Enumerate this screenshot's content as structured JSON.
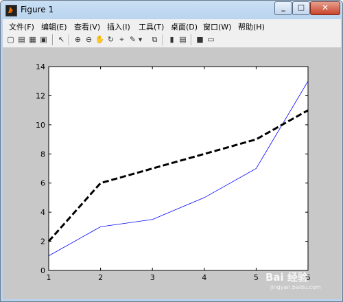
{
  "window": {
    "title": "Figure 1",
    "minimize_glyph": "_",
    "maximize_glyph": "□",
    "close_glyph": "✕"
  },
  "menu": {
    "items": [
      {
        "label": "文件(F)"
      },
      {
        "label": "编辑(E)"
      },
      {
        "label": "查看(V)"
      },
      {
        "label": "插入(I)"
      },
      {
        "label": "工具(T)"
      },
      {
        "label": "桌面(D)"
      },
      {
        "label": "窗口(W)"
      },
      {
        "label": "帮助(H)"
      }
    ]
  },
  "toolbar": {
    "icons": [
      {
        "name": "new-figure-icon",
        "glyph": "▢"
      },
      {
        "name": "open-file-icon",
        "glyph": "▤"
      },
      {
        "name": "save-icon",
        "glyph": "▦"
      },
      {
        "name": "print-icon",
        "glyph": "▣"
      },
      {
        "name": "select-arrow-icon",
        "glyph": "↖"
      },
      {
        "name": "zoom-in-icon",
        "glyph": "⊕"
      },
      {
        "name": "zoom-out-icon",
        "glyph": "⊖"
      },
      {
        "name": "pan-hand-icon",
        "glyph": "✋"
      },
      {
        "name": "rotate-3d-icon",
        "glyph": "↻"
      },
      {
        "name": "data-cursor-icon",
        "glyph": "⌖"
      },
      {
        "name": "brush-icon",
        "glyph": "✎"
      },
      {
        "name": "brush-dropdown-icon",
        "glyph": "▾"
      },
      {
        "name": "link-plot-icon",
        "glyph": "⧉"
      },
      {
        "name": "colorbar-icon",
        "glyph": "▮"
      },
      {
        "name": "legend-icon",
        "glyph": "▤"
      },
      {
        "name": "hide-plot-tools-icon",
        "glyph": "■"
      },
      {
        "name": "show-plot-tools-icon",
        "glyph": "▭"
      }
    ]
  },
  "colors": {
    "series_1": "#0000ff",
    "series_2": "#000000",
    "figure_background": "#c8c8c8",
    "axes_background": "#ffffff"
  },
  "watermark": {
    "logo": "Bai 经验",
    "url": "jingyan.baidu.com"
  },
  "chart_data": {
    "type": "line",
    "x": [
      1,
      2,
      3,
      4,
      5,
      6
    ],
    "series": [
      {
        "values": [
          1,
          3,
          3.5,
          5,
          7,
          13
        ],
        "color": "#0000ff",
        "style": "solid"
      },
      {
        "values": [
          2,
          6,
          7,
          8,
          9,
          11
        ],
        "color": "#000000",
        "style": "dashed"
      }
    ],
    "xlim": [
      1,
      6
    ],
    "ylim": [
      0,
      14
    ],
    "xticks": [
      "1",
      "2",
      "3",
      "4",
      "5",
      "6"
    ],
    "yticks": [
      "0",
      "2",
      "4",
      "6",
      "8",
      "10",
      "12",
      "14"
    ],
    "grid": false,
    "title": "",
    "xlabel": "",
    "ylabel": ""
  }
}
